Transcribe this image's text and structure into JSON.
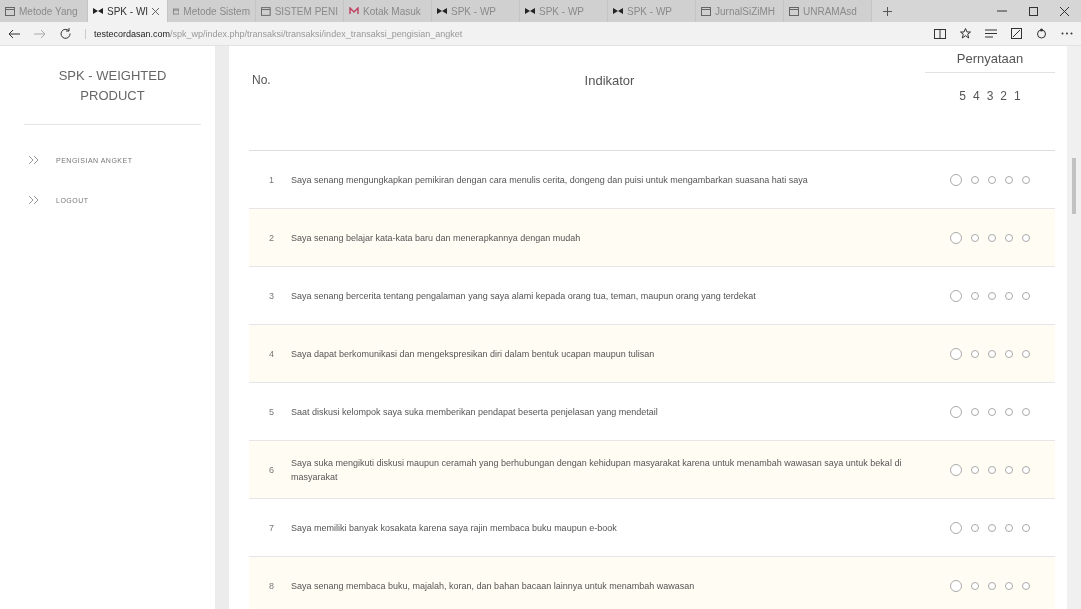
{
  "browser": {
    "tabs": [
      {
        "label": "Metode Yang",
        "selected": false,
        "kind": "page"
      },
      {
        "label": "SPK - WI",
        "selected": true,
        "kind": "bow"
      },
      {
        "label": "Metode Sistem",
        "selected": false,
        "kind": "page"
      },
      {
        "label": "SISTEM PENI",
        "selected": false,
        "kind": "page"
      },
      {
        "label": "Kotak Masuk",
        "selected": false,
        "kind": "mail"
      },
      {
        "label": "SPK - WP",
        "selected": false,
        "kind": "bow"
      },
      {
        "label": "SPK - WP",
        "selected": false,
        "kind": "bow"
      },
      {
        "label": "SPK - WP",
        "selected": false,
        "kind": "bow"
      },
      {
        "label": "JurnalSiZiMH",
        "selected": false,
        "kind": "page"
      },
      {
        "label": "UNRAMAsd",
        "selected": false,
        "kind": "page"
      }
    ],
    "url_host": "testecordasan.com",
    "url_path": "/spk_wp/index.php/transaksi/transaksi/index_transaksi_pengisian_angket"
  },
  "sidebar": {
    "title": "SPK - WEIGHTED PRODUCT",
    "items": [
      {
        "label": "PENGISIAN ANGKET"
      },
      {
        "label": "LOGOUT"
      }
    ]
  },
  "table": {
    "columns": {
      "number": "No.",
      "indicator": "Indikator",
      "statement": "Pernyataan"
    },
    "scale": [
      "5",
      "4",
      "3",
      "2",
      "1"
    ],
    "rows": [
      {
        "number": "1",
        "text": "Saya senang mengungkapkan pemikiran dengan cara menulis cerita, dongeng dan puisi untuk mengambarkan suasana hati saya",
        "choices": [
          {
            "selected": false
          },
          {
            "selected": false
          },
          {
            "selected": false
          },
          {
            "selected": false
          },
          {
            "selected": false
          }
        ]
      },
      {
        "number": "2",
        "text": "Saya senang belajar kata-kata baru dan menerapkannya dengan mudah",
        "choices": [
          {
            "selected": false
          },
          {
            "selected": false
          },
          {
            "selected": false
          },
          {
            "selected": false
          },
          {
            "selected": false
          }
        ]
      },
      {
        "number": "3",
        "text": "Saya senang bercerita tentang pengalaman yang saya alami kepada orang tua, teman, maupun orang yang terdekat",
        "choices": [
          {
            "selected": false
          },
          {
            "selected": false
          },
          {
            "selected": false
          },
          {
            "selected": false
          },
          {
            "selected": false
          }
        ]
      },
      {
        "number": "4",
        "text": "Saya dapat berkomunikasi dan mengekspresikan diri dalam bentuk ucapan maupun tulisan",
        "choices": [
          {
            "selected": false
          },
          {
            "selected": false
          },
          {
            "selected": false
          },
          {
            "selected": false
          },
          {
            "selected": false
          }
        ]
      },
      {
        "number": "5",
        "text": "Saat diskusi kelompok saya suka memberikan pendapat beserta penjelasan yang mendetail",
        "choices": [
          {
            "selected": false
          },
          {
            "selected": false
          },
          {
            "selected": false
          },
          {
            "selected": false
          },
          {
            "selected": false
          }
        ]
      },
      {
        "number": "6",
        "text": "Saya suka mengikuti diskusi maupun ceramah yang berhubungan dengan kehidupan masyarakat karena untuk menambah wawasan saya untuk bekal di masyarakat",
        "choices": [
          {
            "selected": false
          },
          {
            "selected": false
          },
          {
            "selected": false
          },
          {
            "selected": false
          },
          {
            "selected": false
          }
        ]
      },
      {
        "number": "7",
        "text": "Saya memiliki banyak kosakata karena saya rajin membaca buku maupun e-book",
        "choices": [
          {
            "selected": false
          },
          {
            "selected": false
          },
          {
            "selected": false
          },
          {
            "selected": false
          },
          {
            "selected": false
          }
        ]
      },
      {
        "number": "8",
        "text": "Saya senang membaca buku, majalah, koran, dan bahan bacaan lainnya untuk menambah wawasan",
        "choices": [
          {
            "selected": false
          },
          {
            "selected": false
          },
          {
            "selected": false
          },
          {
            "selected": false
          },
          {
            "selected": false
          }
        ]
      }
    ]
  }
}
